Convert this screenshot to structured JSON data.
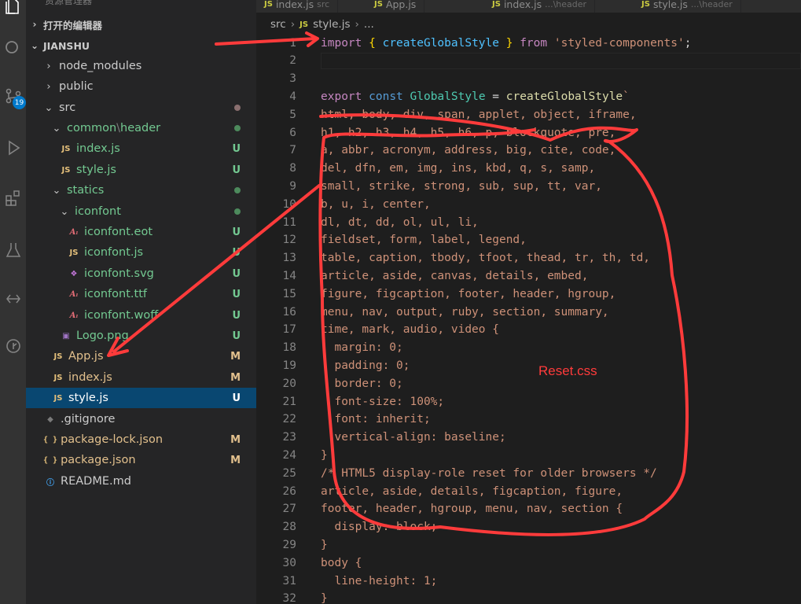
{
  "activity_bar": {
    "icons": [
      "explorer-icon",
      "search-icon",
      "source-control-icon",
      "run-debug-icon",
      "extensions-icon",
      "test-icon",
      "remote-icon",
      "git-graph-icon"
    ],
    "badge": "19"
  },
  "sidebar": {
    "clipped_title": "资源管理器",
    "open_editors_label": "打开的编辑器",
    "project_label": "JIANSHU",
    "tree": [
      {
        "label": "node_modules",
        "type": "folder",
        "open": false,
        "status": ""
      },
      {
        "label": "public",
        "type": "folder",
        "open": false,
        "status": ""
      },
      {
        "label": "src",
        "type": "folder",
        "open": true,
        "status": "dot-gray"
      },
      {
        "label": "common",
        "label2": "header",
        "type": "folder",
        "open": true,
        "status": "dot-green"
      },
      {
        "label": "index.js",
        "type": "js",
        "status": "U"
      },
      {
        "label": "style.js",
        "type": "js",
        "status": "U"
      },
      {
        "label": "statics",
        "type": "folder",
        "open": true,
        "status": "dot-green"
      },
      {
        "label": "iconfont",
        "type": "folder",
        "open": true,
        "status": "dot-green"
      },
      {
        "label": "iconfont.eot",
        "type": "font",
        "status": "U"
      },
      {
        "label": "iconfont.js",
        "type": "js",
        "status": "U"
      },
      {
        "label": "iconfont.svg",
        "type": "svg",
        "status": "U"
      },
      {
        "label": "iconfont.ttf",
        "type": "font",
        "status": "U"
      },
      {
        "label": "iconfont.woff",
        "type": "font",
        "status": "U"
      },
      {
        "label": "Logo.png",
        "type": "png",
        "status": "U"
      },
      {
        "label": "App.js",
        "type": "js",
        "status": "M"
      },
      {
        "label": "index.js",
        "type": "js",
        "status": "M"
      },
      {
        "label": "style.js",
        "type": "js",
        "status": "U",
        "selected": true
      },
      {
        "label": ".gitignore",
        "type": "git",
        "status": ""
      },
      {
        "label": "package-lock.json",
        "type": "json",
        "status": "M"
      },
      {
        "label": "package.json",
        "type": "json",
        "status": "M"
      },
      {
        "label": "README.md",
        "type": "info",
        "status": ""
      }
    ]
  },
  "tabs": [
    {
      "label": "index.js",
      "sub": "src"
    },
    {
      "label": "App.js",
      "sub": ""
    },
    {
      "label": "index.js",
      "sub": "...\\header"
    },
    {
      "label": "style.js",
      "sub": "...\\header"
    }
  ],
  "breadcrumb": {
    "folder": "src",
    "file": "style.js",
    "rest": "..."
  },
  "code_lines": [
    {
      "n": "1",
      "html": "<span class='kw'>import</span> <span class='brace'>{</span> <span class='var'>createGlobalStyle</span> <span class='brace'>}</span> <span class='kw'>from</span> <span class='str'>'styled-components'</span><span class='punc'>;</span>"
    },
    {
      "n": "2",
      "html": "",
      "current": true
    },
    {
      "n": "3",
      "html": ""
    },
    {
      "n": "4",
      "html": "<span class='kw'>export</span> <span class='k'>const</span> <span class='type'>GlobalStyle</span> <span class='punc'>=</span> <span class='fn'>createGlobalStyle</span><span class='str'>`</span>"
    },
    {
      "n": "5",
      "html": "<span class='css-text'>html, body, div, span, applet, object, iframe,</span>"
    },
    {
      "n": "6",
      "html": "<span class='css-text'>h1, h2, h3, h4, h5, h6, p, blockquote, pre,</span>"
    },
    {
      "n": "7",
      "html": "<span class='css-text'>a, abbr, acronym, address, big, cite, code,</span>"
    },
    {
      "n": "8",
      "html": "<span class='css-text'>del, dfn, em, img, ins, kbd, q, s, samp,</span>"
    },
    {
      "n": "9",
      "html": "<span class='css-text'>small, strike, strong, sub, sup, tt, var,</span>"
    },
    {
      "n": "10",
      "html": "<span class='css-text'>b, u, i, center,</span>"
    },
    {
      "n": "11",
      "html": "<span class='css-text'>dl, dt, dd, ol, ul, li,</span>"
    },
    {
      "n": "12",
      "html": "<span class='css-text'>fieldset, form, label, legend,</span>"
    },
    {
      "n": "13",
      "html": "<span class='css-text'>table, caption, tbody, tfoot, thead, tr, th, td,</span>"
    },
    {
      "n": "14",
      "html": "<span class='css-text'>article, aside, canvas, details, embed,</span>"
    },
    {
      "n": "15",
      "html": "<span class='css-text'>figure, figcaption, footer, header, hgroup,</span>"
    },
    {
      "n": "16",
      "html": "<span class='css-text'>menu, nav, output, ruby, section, summary,</span>"
    },
    {
      "n": "17",
      "html": "<span class='css-text'>time, mark, audio, video {</span>"
    },
    {
      "n": "18",
      "html": "<span class='css-text'>  margin: 0;</span>"
    },
    {
      "n": "19",
      "html": "<span class='css-text'>  padding: 0;</span>"
    },
    {
      "n": "20",
      "html": "<span class='css-text'>  border: 0;</span>"
    },
    {
      "n": "21",
      "html": "<span class='css-text'>  font-size: 100%;</span>"
    },
    {
      "n": "22",
      "html": "<span class='css-text'>  font: inherit;</span>"
    },
    {
      "n": "23",
      "html": "<span class='css-text'>  vertical-align: baseline;</span>"
    },
    {
      "n": "24",
      "html": "<span class='css-text'>}</span>"
    },
    {
      "n": "25",
      "html": "<span class='css-text'>/* HTML5 display-role reset for older browsers */</span>"
    },
    {
      "n": "26",
      "html": "<span class='css-text'>article, aside, details, figcaption, figure,</span>"
    },
    {
      "n": "27",
      "html": "<span class='css-text'>footer, header, hgroup, menu, nav, section {</span>"
    },
    {
      "n": "28",
      "html": "<span class='css-text'>  display: block;</span>"
    },
    {
      "n": "29",
      "html": "<span class='css-text'>}</span>"
    },
    {
      "n": "30",
      "html": "<span class='css-text'>body {</span>"
    },
    {
      "n": "31",
      "html": "<span class='css-text'>  line-height: 1;</span>"
    },
    {
      "n": "32",
      "html": "<span class='css-text'>}</span>"
    }
  ],
  "annotation": {
    "label": "Reset.css",
    "color": "#ff3b3b"
  }
}
